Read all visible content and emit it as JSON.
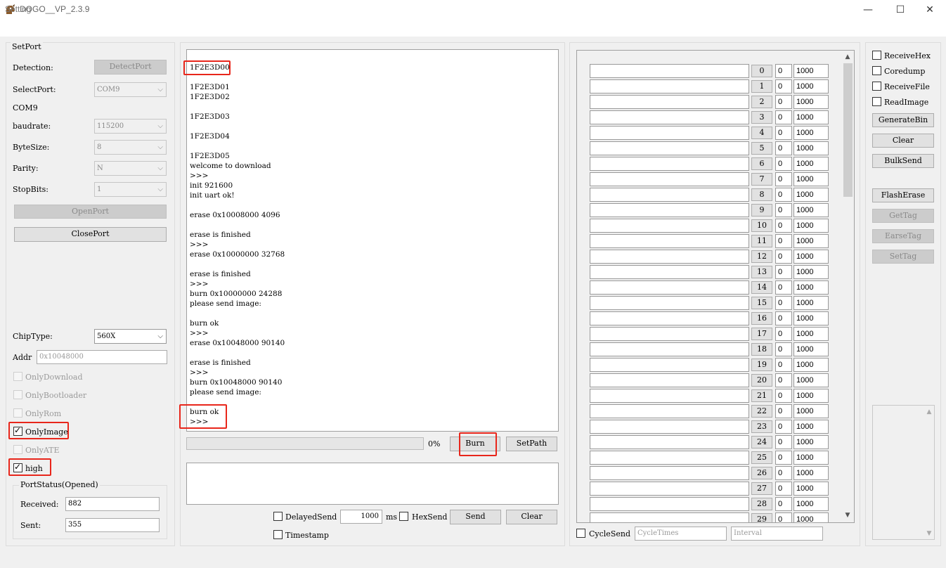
{
  "window": {
    "title": "DOGO__VP_2.3.9",
    "minimize": "—",
    "maximize": "☐",
    "close": "✕"
  },
  "menu": {
    "setting": "Setting"
  },
  "setport": {
    "legend": "SetPort",
    "detection_label": "Detection:",
    "detect_button": "DetectPort",
    "selectport_label": "SelectPort:",
    "selectport_value": "COM9",
    "current_port": "COM9",
    "baudrate_label": "baudrate:",
    "baudrate_value": "115200",
    "bytesize_label": "ByteSize:",
    "bytesize_value": "8",
    "parity_label": "Parity:",
    "parity_value": "N",
    "stopbits_label": "StopBits:",
    "stopbits_value": "1",
    "open_button": "OpenPort",
    "close_button": "ClosePort",
    "chiptype_label": "ChipType:",
    "chiptype_value": "560X",
    "addr_label": "Addr",
    "addr_placeholder": "0x10048000",
    "only_download": "OnlyDownload",
    "only_bootloader": "OnlyBootloader",
    "only_rom": "OnlyRom",
    "only_image": "OnlyImage",
    "only_ate": "OnlyATE",
    "high": "high",
    "portstatus_legend": "PortStatus(Opened)",
    "received_label": "Received:",
    "received_value": "882",
    "sent_label": "Sent:",
    "sent_value": "355"
  },
  "console": {
    "lines": "1F2E3D00\n\n1F2E3D01\n1F2E3D02\n\n1F2E3D03\n\n1F2E3D04\n\n1F2E3D05\nwelcome to download\n>>>\ninit 921600\ninit uart ok!\n\nerase 0x10008000 4096\n\nerase is finished\n>>>\nerase 0x10000000 32768\n\nerase is finished\n>>>\nburn 0x10000000 24288\nplease send image:\n\nburn ok\n>>>\nerase 0x10048000 90140\n\nerase is finished\n>>>\nburn 0x10048000 90140\nplease send image:\n",
    "tail": "burn ok\n>>>"
  },
  "progress": {
    "percent_text": "0%",
    "fraction": 0,
    "burn_button": "Burn",
    "setpath_button": "SetPath"
  },
  "send": {
    "delayed_send": "DelayedSend",
    "delay_value": "1000",
    "ms": "ms",
    "hex_send": "HexSend",
    "send_button": "Send",
    "clear_button": "Clear",
    "timestamp": "Timestamp"
  },
  "cycle": {
    "rows": [
      {
        "idx": "0",
        "count": "0",
        "interval": "1000"
      },
      {
        "idx": "1",
        "count": "0",
        "interval": "1000"
      },
      {
        "idx": "2",
        "count": "0",
        "interval": "1000"
      },
      {
        "idx": "3",
        "count": "0",
        "interval": "1000"
      },
      {
        "idx": "4",
        "count": "0",
        "interval": "1000"
      },
      {
        "idx": "5",
        "count": "0",
        "interval": "1000"
      },
      {
        "idx": "6",
        "count": "0",
        "interval": "1000"
      },
      {
        "idx": "7",
        "count": "0",
        "interval": "1000"
      },
      {
        "idx": "8",
        "count": "0",
        "interval": "1000"
      },
      {
        "idx": "9",
        "count": "0",
        "interval": "1000"
      },
      {
        "idx": "10",
        "count": "0",
        "interval": "1000"
      },
      {
        "idx": "11",
        "count": "0",
        "interval": "1000"
      },
      {
        "idx": "12",
        "count": "0",
        "interval": "1000"
      },
      {
        "idx": "13",
        "count": "0",
        "interval": "1000"
      },
      {
        "idx": "14",
        "count": "0",
        "interval": "1000"
      },
      {
        "idx": "15",
        "count": "0",
        "interval": "1000"
      },
      {
        "idx": "16",
        "count": "0",
        "interval": "1000"
      },
      {
        "idx": "17",
        "count": "0",
        "interval": "1000"
      },
      {
        "idx": "18",
        "count": "0",
        "interval": "1000"
      },
      {
        "idx": "19",
        "count": "0",
        "interval": "1000"
      },
      {
        "idx": "20",
        "count": "0",
        "interval": "1000"
      },
      {
        "idx": "21",
        "count": "0",
        "interval": "1000"
      },
      {
        "idx": "22",
        "count": "0",
        "interval": "1000"
      },
      {
        "idx": "23",
        "count": "0",
        "interval": "1000"
      },
      {
        "idx": "24",
        "count": "0",
        "interval": "1000"
      },
      {
        "idx": "25",
        "count": "0",
        "interval": "1000"
      },
      {
        "idx": "26",
        "count": "0",
        "interval": "1000"
      },
      {
        "idx": "27",
        "count": "0",
        "interval": "1000"
      },
      {
        "idx": "28",
        "count": "0",
        "interval": "1000"
      },
      {
        "idx": "29",
        "count": "0",
        "interval": "1000"
      }
    ],
    "cycle_send": "CycleSend",
    "cycle_times_placeholder": "CycleTimes",
    "interval_placeholder": "Interval"
  },
  "right": {
    "receive_hex": "ReceiveHex",
    "coredump": "Coredump",
    "receive_file": "ReceiveFile",
    "read_image": "ReadImage",
    "generate_bin": "GenerateBin",
    "clear": "Clear",
    "bulk_send": "BulkSend",
    "flash_erase": "FlashErase",
    "get_tag": "GetTag",
    "earse_tag": "EarseTag",
    "set_tag": "SetTag"
  },
  "icons": {
    "scroll_up": "▲",
    "scroll_down": "▼",
    "chevron": "⌵"
  }
}
